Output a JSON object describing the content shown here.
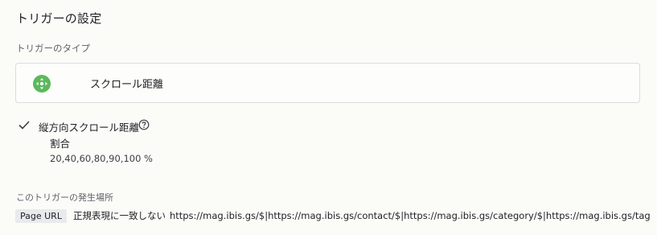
{
  "panel": {
    "title": "トリガーの設定",
    "type_section_label": "トリガーのタイプ"
  },
  "trigger_type": {
    "name": "スクロール距離",
    "icon": "scroll-move-icon",
    "icon_color": "#5cb85c"
  },
  "condition": {
    "title": "縦方向スクロール距離",
    "help_icon": "help-circle-icon",
    "sub_label": "割合",
    "sub_value": "20,40,60,80,90,100 %"
  },
  "firing": {
    "label": "このトリガーの発生場所",
    "variable": "Page URL",
    "operator": "正規表現に一致しない",
    "value": "https://mag.ibis.gs/$|https://mag.ibis.gs/contact/$|https://mag.ibis.gs/category/$|https://mag.ibis.gs/tag/$"
  }
}
